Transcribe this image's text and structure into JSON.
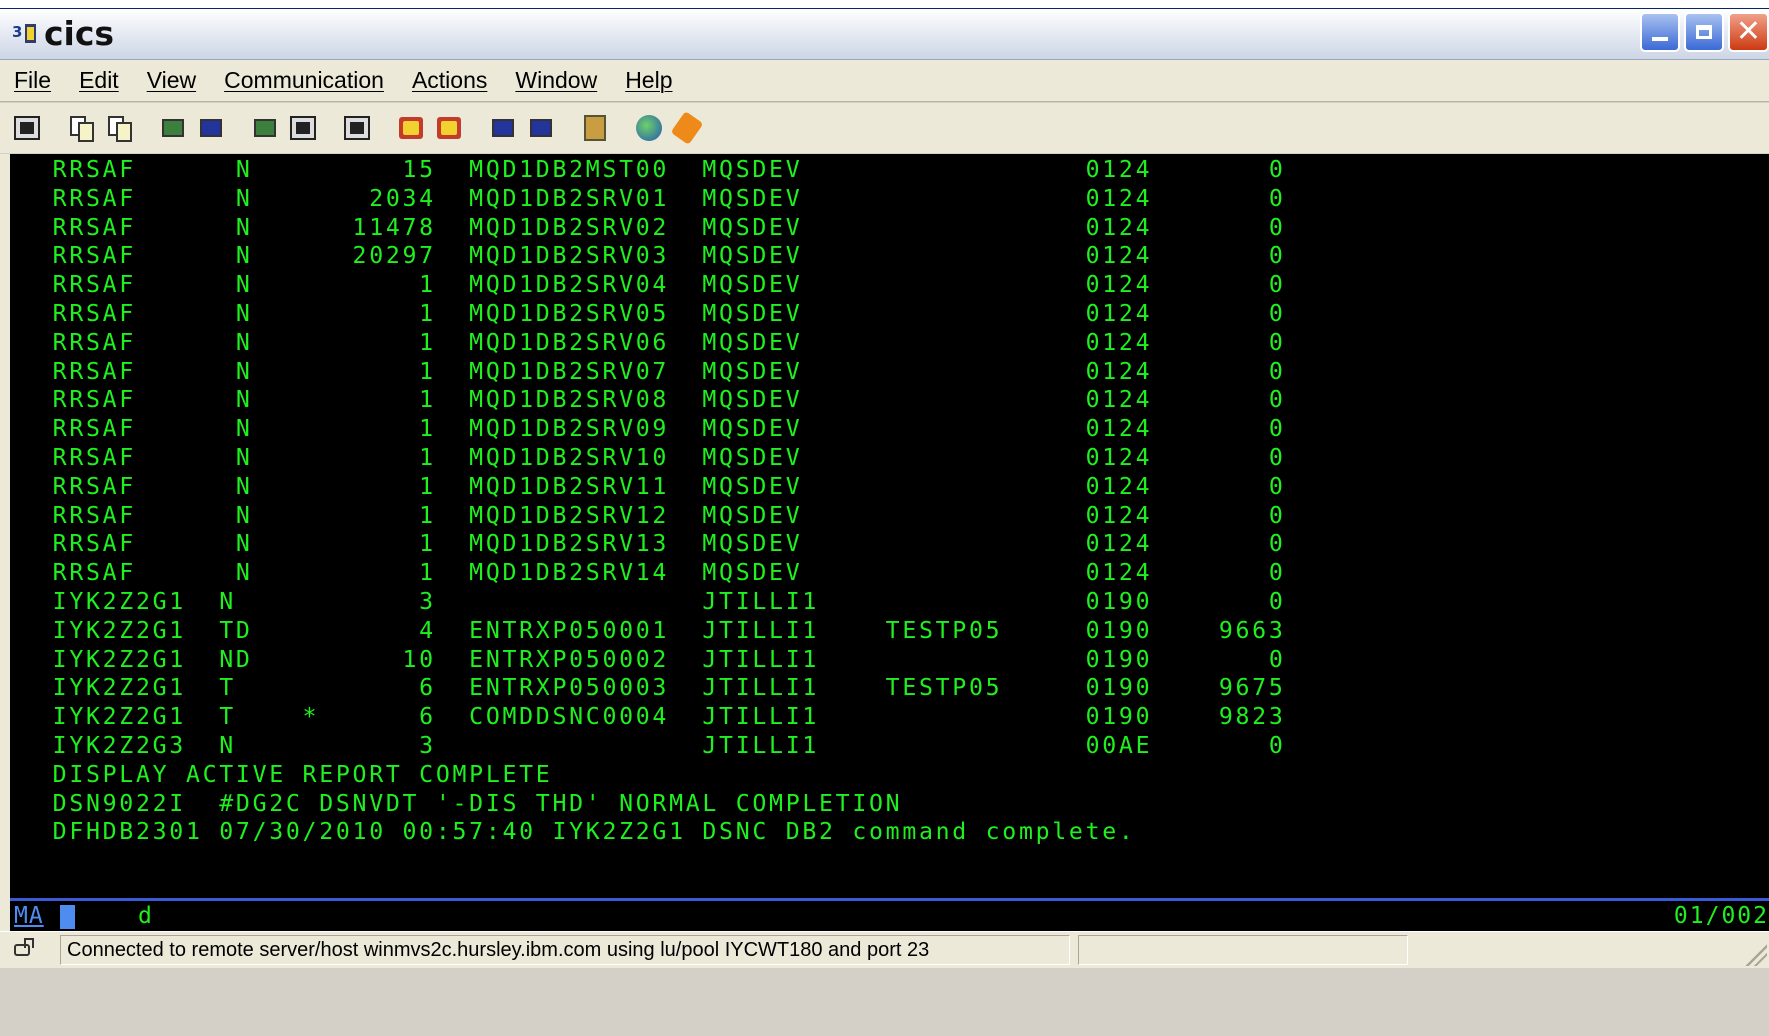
{
  "window": {
    "title": "cics"
  },
  "menu": [
    {
      "label": "File"
    },
    {
      "label": "Edit"
    },
    {
      "label": "View"
    },
    {
      "label": "Communication"
    },
    {
      "label": "Actions"
    },
    {
      "label": "Window"
    },
    {
      "label": "Help"
    }
  ],
  "toolbar_icons": [
    "session-icon",
    "copy-icon",
    "paste-icon",
    "send-file-icon",
    "receive-file-icon",
    "screen-icon-1",
    "screen-icon-2",
    "keyboard-icon",
    "record-macro-icon",
    "stop-macro-icon",
    "play-macro-icon",
    "macro-list-icon",
    "clipboard-icon",
    "globe-icon",
    "tag-icon"
  ],
  "terminal": {
    "rows": [
      " RRSAF      N         15  MQD1DB2MST00  MQSDEV                 0124       0",
      " RRSAF      N       2034  MQD1DB2SRV01  MQSDEV                 0124       0",
      " RRSAF      N      11478  MQD1DB2SRV02  MQSDEV                 0124       0",
      " RRSAF      N      20297  MQD1DB2SRV03  MQSDEV                 0124       0",
      " RRSAF      N          1  MQD1DB2SRV04  MQSDEV                 0124       0",
      " RRSAF      N          1  MQD1DB2SRV05  MQSDEV                 0124       0",
      " RRSAF      N          1  MQD1DB2SRV06  MQSDEV                 0124       0",
      " RRSAF      N          1  MQD1DB2SRV07  MQSDEV                 0124       0",
      " RRSAF      N          1  MQD1DB2SRV08  MQSDEV                 0124       0",
      " RRSAF      N          1  MQD1DB2SRV09  MQSDEV                 0124       0",
      " RRSAF      N          1  MQD1DB2SRV10  MQSDEV                 0124       0",
      " RRSAF      N          1  MQD1DB2SRV11  MQSDEV                 0124       0",
      " RRSAF      N          1  MQD1DB2SRV12  MQSDEV                 0124       0",
      " RRSAF      N          1  MQD1DB2SRV13  MQSDEV                 0124       0",
      " RRSAF      N          1  MQD1DB2SRV14  MQSDEV                 0124       0",
      " IYK2Z2G1  N           3                JTILLI1                0190       0",
      " IYK2Z2G1  TD          4  ENTRXP050001  JTILLI1    TESTP05     0190    9663",
      " IYK2Z2G1  ND         10  ENTRXP050002  JTILLI1                0190       0",
      " IYK2Z2G1  T           6  ENTRXP050003  JTILLI1    TESTP05     0190    9675",
      " IYK2Z2G1  T    *      6  COMDDSNC0004  JTILLI1                0190    9823",
      " IYK2Z2G3  N           3                JTILLI1                00AE       0",
      " DISPLAY ACTIVE REPORT COMPLETE",
      " DSN9022I  #DG2C DSNVDT '-DIS THD' NORMAL COMPLETION",
      " DFHDB2301 07/30/2010 00:57:40 IYK2Z2G1 DSNC DB2 command complete."
    ]
  },
  "oia": {
    "indicator": "MA",
    "input": "d",
    "cursor_position": "01/002"
  },
  "status": {
    "connection_text": "Connected to remote server/host winmvs2c.hursley.ibm.com using lu/pool IYCWT180 and port 23"
  }
}
